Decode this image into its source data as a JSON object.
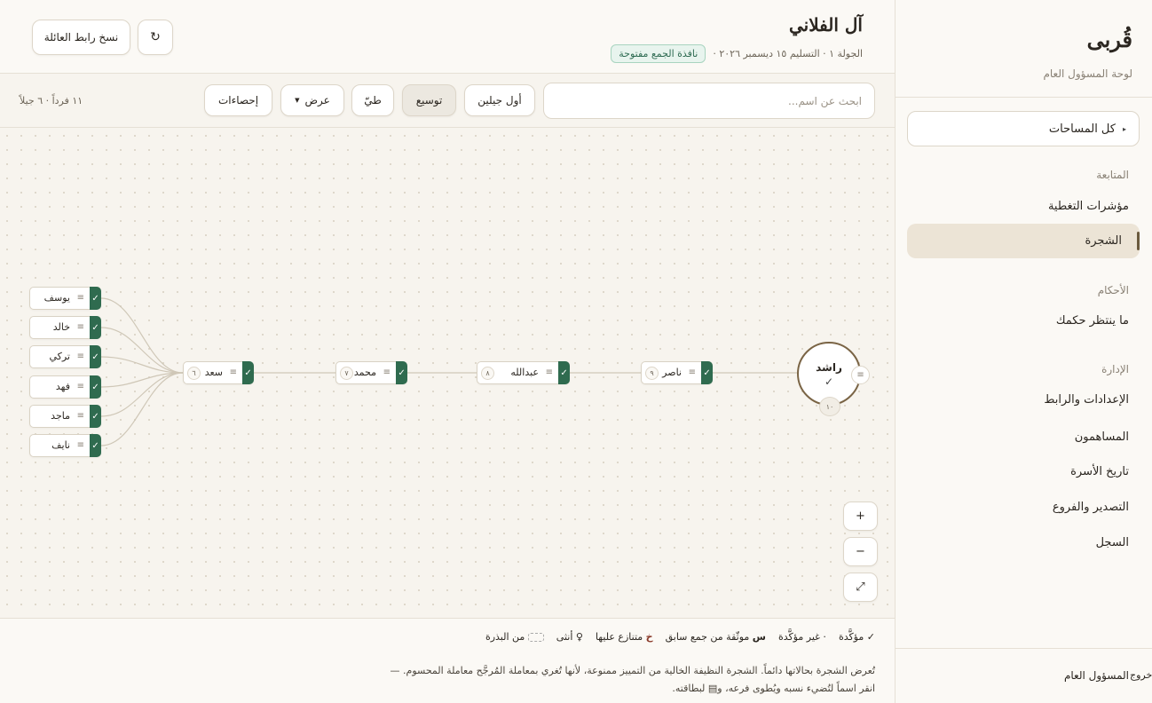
{
  "sidebar": {
    "brand": "قُربى",
    "subtitle": "لوحة المسؤول العام",
    "space_select": "كل المساحات",
    "sections": {
      "follow": "المتابعة",
      "rulings": "الأحكام",
      "admin": "الإدارة"
    },
    "items": {
      "coverage": "مؤشرات التغطية",
      "tree": "الشجرة",
      "pending": "ما ينتظر حكمك",
      "settings": "الإعدادات والرابط",
      "contributors": "المساهمون",
      "history": "تاريخ الأسرة",
      "export": "التصدير والفروع",
      "log": "السجل"
    },
    "user": "المسؤول العام",
    "logout": "خروج"
  },
  "header": {
    "title": "آل الفلاني",
    "meta": "الجولة ١ · التسليم ١٥ ديسمبر ٢٠٢٦ ·",
    "status": "نافذة الجمع مفتوحة",
    "copy_link": "نسخ رابط العائلة",
    "refresh": "↻"
  },
  "toolbar": {
    "search_placeholder": "ابحث عن اسم...",
    "first_two": "أول جيلين",
    "expand": "توسيع",
    "collapse": "طيّ",
    "view": "عرض",
    "stats": "إحصاءات",
    "counter": "١١ فرداً · ٦ جيلاً"
  },
  "tree": {
    "root": {
      "name": "راشد",
      "check": "✓",
      "count": "١٠",
      "menu": "≡"
    },
    "chain": [
      {
        "name": "ناصر",
        "count": "٩"
      },
      {
        "name": "عبدالله",
        "count": "٨"
      },
      {
        "name": "محمد",
        "count": "٧"
      },
      {
        "name": "سعد",
        "count": "٦"
      }
    ],
    "leaves": [
      "يوسف",
      "خالد",
      "تركي",
      "فهد",
      "ماجد",
      "نايف"
    ],
    "check": "✓",
    "menu": "≡"
  },
  "zoom": {
    "in": "+",
    "out": "−",
    "fit": "⤢"
  },
  "legend": {
    "confirmed": "✓ مؤكَّدة",
    "unconfirmed": "· غير مؤكَّدة",
    "prev_key": "س",
    "prev": "موثّقة من جمع سابق",
    "disputed_key": "خ",
    "disputed": "متنازع عليها",
    "female": "♀ أنثى",
    "seed": "من البذرة"
  },
  "notes": {
    "line1": "تُعرض الشجرة بحالاتها دائماً. الشجرة النظيفة الخالية من التمييز ممنوعة، لأنها تُغري بمعاملة المُرجَّح معاملة المحسوم. —",
    "line2": "انقر اسماً لتُضيء نسبه ويُطوى فرعه، و▤ لبطاقته."
  }
}
